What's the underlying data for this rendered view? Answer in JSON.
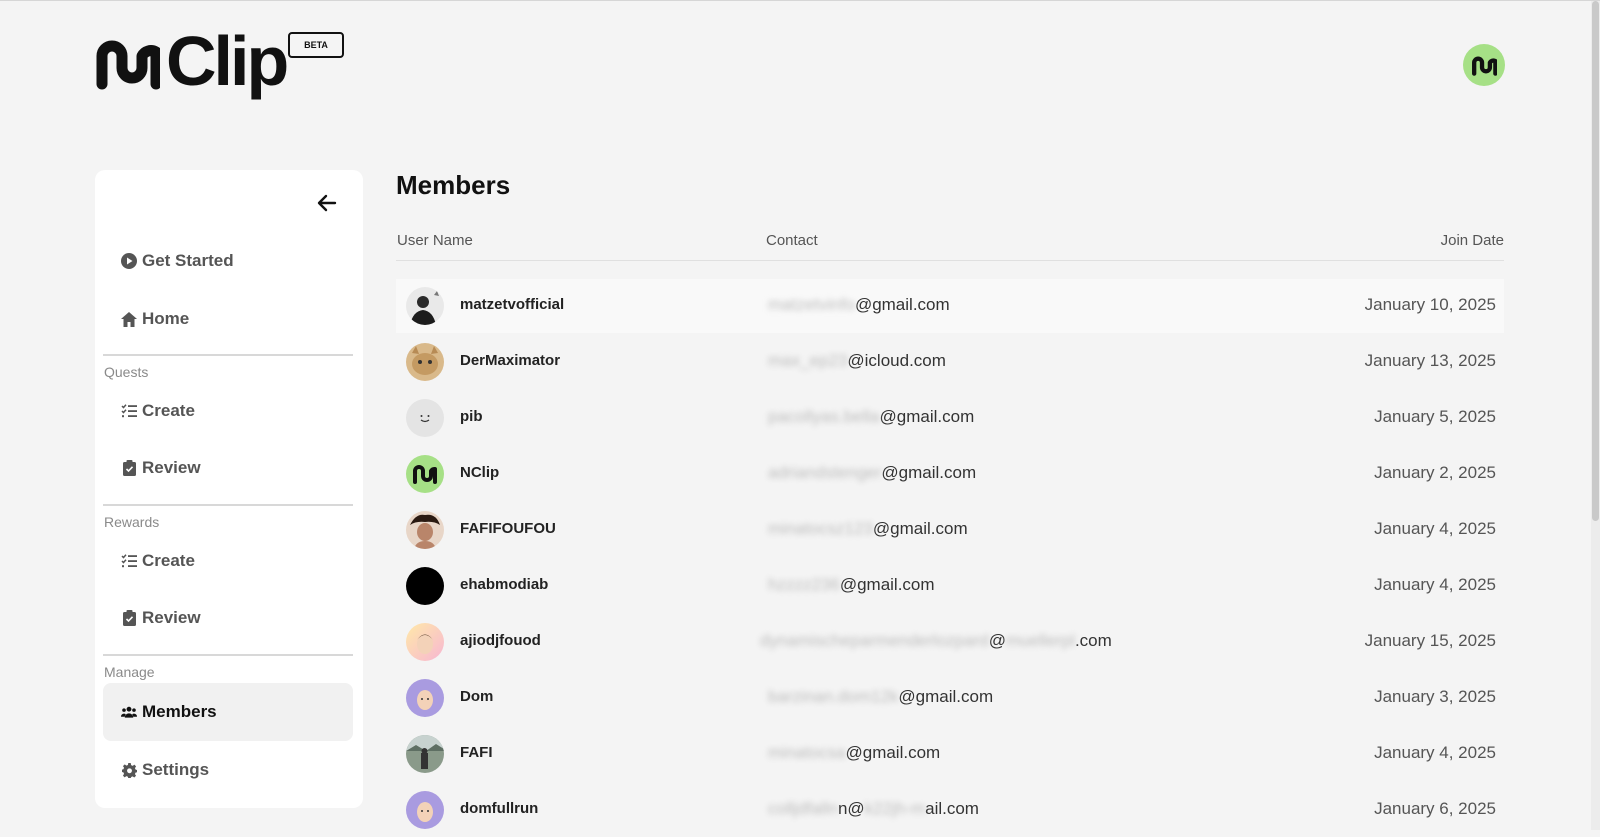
{
  "app": {
    "logo_text": "Clip",
    "badge": "BETA"
  },
  "sidebar": {
    "items": [
      {
        "label": "Get Started",
        "icon": "play-circle-icon"
      },
      {
        "label": "Home",
        "icon": "home-icon"
      }
    ],
    "quests": {
      "section_label": "Quests",
      "items": [
        {
          "label": "Create",
          "icon": "list-check-icon"
        },
        {
          "label": "Review",
          "icon": "clipboard-check-icon"
        }
      ]
    },
    "rewards": {
      "section_label": "Rewards",
      "items": [
        {
          "label": "Create",
          "icon": "list-check-icon"
        },
        {
          "label": "Review",
          "icon": "clipboard-check-icon"
        }
      ]
    },
    "manage": {
      "section_label": "Manage",
      "items": [
        {
          "label": "Members",
          "icon": "users-icon",
          "active": true
        },
        {
          "label": "Settings",
          "icon": "gear-icon"
        }
      ]
    }
  },
  "main": {
    "title": "Members",
    "columns": {
      "username": "User Name",
      "contact": "Contact",
      "join_date": "Join Date"
    },
    "rows": [
      {
        "username": "matzetvofficial",
        "contact_hidden": "matzetvinfo",
        "contact_visible": "@gmail.com",
        "join_date": "January 10, 2025"
      },
      {
        "username": "DerMaximator",
        "contact_hidden": "max_ep23",
        "contact_visible": "@icloud.com",
        "join_date": "January 13, 2025"
      },
      {
        "username": "pib",
        "contact_hidden": "pacollyas.bella",
        "contact_visible": "@gmail.com",
        "join_date": "January 5, 2025"
      },
      {
        "username": "NClip",
        "contact_hidden": "adriandstenger",
        "contact_visible": "@gmail.com",
        "join_date": "January 2, 2025"
      },
      {
        "username": "FAFIFOUFOU",
        "contact_hidden": "minatocsz123",
        "contact_visible": "@gmail.com",
        "join_date": "January 4, 2025"
      },
      {
        "username": "ehabmodiab",
        "contact_hidden": "hzzzz236",
        "contact_visible": "@gmail.com",
        "join_date": "January 4, 2025"
      },
      {
        "username": "ajiodjfouod",
        "contact_hidden": "dynamischeparmenderlozpard",
        "contact_visible": "@",
        "contact_hidden2": "muellerpl",
        "contact_visible2": ".com",
        "join_date": "January 15, 2025"
      },
      {
        "username": "Dom",
        "contact_hidden": "barzinan.dom12k",
        "contact_visible": "@gmail.com",
        "join_date": "January 3, 2025"
      },
      {
        "username": "FAFI",
        "contact_hidden": "minatocsa",
        "contact_visible": "@gmail.com",
        "join_date": "January 4, 2025"
      },
      {
        "username": "domfullrun",
        "contact_hidden": "colljdfalln",
        "contact_visible": "n@",
        "contact_hidden2": "k22jh-m",
        "contact_visible2": "ail.com",
        "join_date": "January 6, 2025"
      }
    ]
  }
}
